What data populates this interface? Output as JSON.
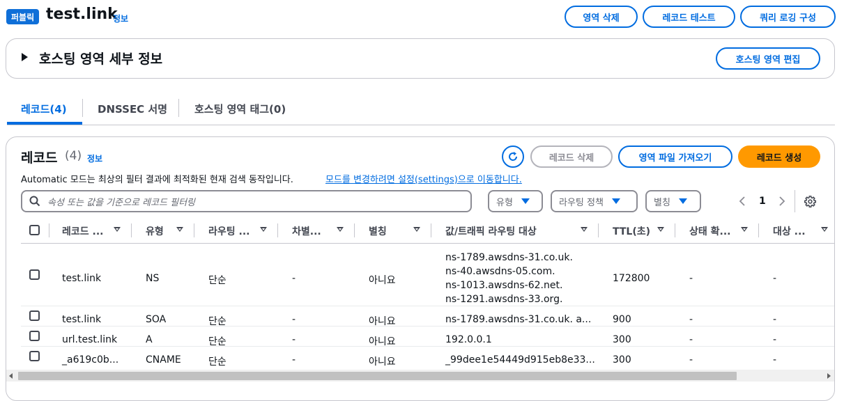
{
  "header": {
    "badge": "퍼블릭",
    "title": "test.link",
    "info": "정보",
    "buttons": {
      "delete_zone": "영역 삭제",
      "test_record": "레코드 테스트",
      "query_logging": "쿼리 로깅 구성"
    }
  },
  "hosted_zone_details": {
    "title": "호스팅 영역 세부 정보",
    "edit_button": "호스팅 영역 편집"
  },
  "tabs": [
    {
      "label": "레코드(4)",
      "active": true
    },
    {
      "label": "DNSSEC 서명",
      "active": false
    },
    {
      "label": "호스팅 영역 태그(0)",
      "active": false
    }
  ],
  "records": {
    "title": "레코드",
    "count": "(4)",
    "info": "정보",
    "description": "Automatic 모드는 최상의 필터 결과에 최적화된 현재 검색 동작입니다.",
    "settings_link": "모드를 변경하려면 설정(settings)으로 이동합니다.",
    "buttons": {
      "delete": "레코드 삭제",
      "import": "영역 파일 가져오기",
      "create": "레코드 생성"
    },
    "search": {
      "placeholder": "속성 또는 값을 기준으로 레코드 필터링"
    },
    "filters": {
      "type": "유형",
      "routing_policy": "라우팅 정책",
      "alias": "별칭"
    },
    "pagination": {
      "page": "1"
    },
    "columns": [
      "레코드 ...",
      "유형",
      "라우팅 ...",
      "차별...",
      "별칭",
      "값/트래픽 라우팅 대상",
      "TTL(초)",
      "상태 확...",
      "대상 ..."
    ],
    "rows": [
      {
        "name": "test.link",
        "type": "NS",
        "routing": "단순",
        "diff": "-",
        "alias": "아니요",
        "values": [
          "ns-1789.awsdns-31.co.uk.",
          "ns-40.awsdns-05.com.",
          "ns-1013.awsdns-62.net.",
          "ns-1291.awsdns-33.org."
        ],
        "ttl": "172800",
        "health": "-",
        "target": "-"
      },
      {
        "name": "test.link",
        "type": "SOA",
        "routing": "단순",
        "diff": "-",
        "alias": "아니요",
        "values": [
          "ns-1789.awsdns-31.co.uk. a..."
        ],
        "ttl": "900",
        "health": "-",
        "target": "-"
      },
      {
        "name": "url.test.link",
        "type": "A",
        "routing": "단순",
        "diff": "-",
        "alias": "아니요",
        "values": [
          "192.0.0.1"
        ],
        "ttl": "300",
        "health": "-",
        "target": "-"
      },
      {
        "name": "_a619c0b...",
        "type": "CNAME",
        "routing": "단순",
        "diff": "-",
        "alias": "아니요",
        "values": [
          "_99dee1e54449d915eb8e33..."
        ],
        "ttl": "300",
        "health": "-",
        "target": "-"
      }
    ]
  },
  "icons": [
    "refresh-icon",
    "search-icon",
    "chevron-left-icon",
    "chevron-right-icon",
    "gear-icon",
    "caret-right-icon",
    "sort-icon"
  ],
  "colors": {
    "accent": "#006ce0",
    "primary_button": "#ff9900",
    "badge": "#0f6fd8"
  }
}
